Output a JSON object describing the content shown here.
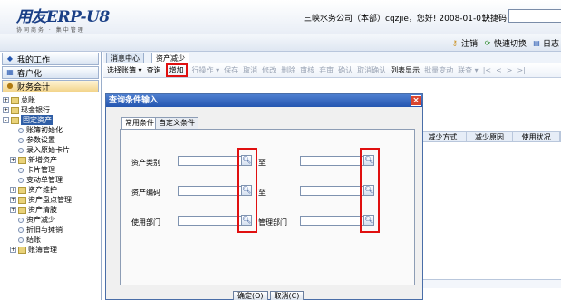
{
  "header": {
    "logo": "用友ERP-U8",
    "logo_sub": "协同商务 · 集中管理",
    "company_info": "三峡水务公司（本部）cqzjie，您好! 2008-01-01",
    "quick_code_label": "快捷码",
    "quick_code_value": ""
  },
  "subbar": {
    "logout": "注销",
    "quick_switch": "快速切换",
    "diary": "日志"
  },
  "sidebar": {
    "buttons": [
      "我的工作",
      "客户化",
      "财务会计"
    ],
    "tree": [
      {
        "label": "总账",
        "level": 1,
        "toggle": "+"
      },
      {
        "label": "现金银行",
        "level": 1,
        "toggle": "+"
      },
      {
        "label": "固定资产",
        "level": 1,
        "toggle": "-",
        "selected": true
      },
      {
        "label": "账簿初始化",
        "level": 2
      },
      {
        "label": "参数设置",
        "level": 2
      },
      {
        "label": "录入原始卡片",
        "level": 2
      },
      {
        "label": "新增资产",
        "level": 2,
        "toggle": "+"
      },
      {
        "label": "卡片管理",
        "level": 2
      },
      {
        "label": "变动单管理",
        "level": 2
      },
      {
        "label": "资产维护",
        "level": 2,
        "toggle": "+"
      },
      {
        "label": "资产盘点管理",
        "level": 2,
        "toggle": "+"
      },
      {
        "label": "资产清肢",
        "level": 2,
        "toggle": "+"
      },
      {
        "label": "资产减少",
        "level": 2
      },
      {
        "label": "折旧与摊销",
        "level": 2
      },
      {
        "label": "结账",
        "level": 2
      },
      {
        "label": "账簿管理",
        "level": 2,
        "toggle": "+"
      }
    ]
  },
  "tabs": [
    "消息中心",
    "资产减少"
  ],
  "toolbar": [
    "选择账簿 ▾",
    "查询",
    "增加",
    "行操作 ▾",
    "保存",
    "取消",
    "修改",
    "删除",
    "审核",
    "弃审",
    "确认",
    "取消确认",
    "列表显示",
    "批量变动",
    "联查 ▾",
    "|<",
    "<",
    ">",
    ">|"
  ],
  "grid_headers": [
    "减少方式",
    "减少原因",
    "使用状况"
  ],
  "dialog": {
    "title": "查询条件输入",
    "close": "×",
    "tabs": [
      "常用条件",
      "自定义条件"
    ],
    "fields": {
      "asset_type": "资产类别",
      "asset_code": "资产编码",
      "use_dept": "使用部门",
      "to": "至",
      "manage_dept": "管理部门"
    },
    "ok": "确定(O)",
    "cancel": "取消(C)"
  },
  "icons": {
    "search": "magnifier-icon",
    "folder": "folder-icon",
    "doc": "doc-icon"
  },
  "colors": {
    "title_bar": "#2456b0",
    "highlight": "#e01010",
    "selected_node": "#2f5ea6"
  }
}
